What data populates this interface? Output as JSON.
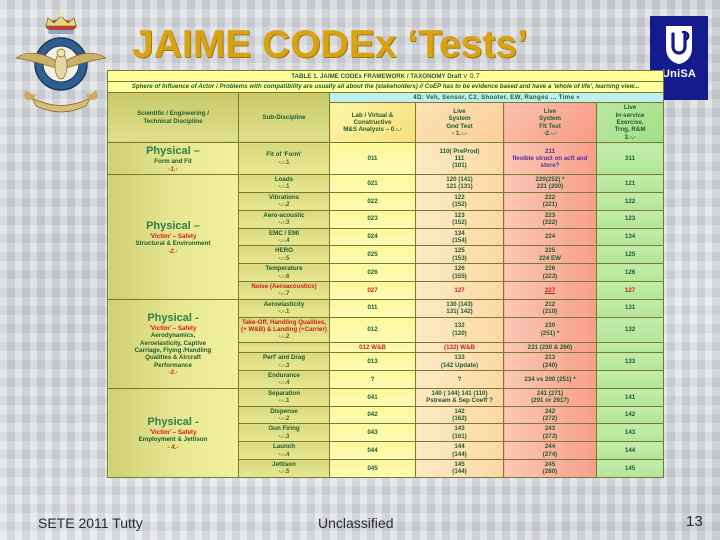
{
  "slide": {
    "title": "JAIME CODEx ‘Tests’",
    "title_color": "#d9a213",
    "background_color": "#c9ccd1"
  },
  "logos": {
    "raaf": "raaf-crest-icon",
    "unisa_label": "UniSA",
    "unisa_color": "#141b8c"
  },
  "table": {
    "title_main": "TABLE 1. JAIME CODEx FRAMEWORK / TAXONOMY Draft",
    "title_version": "v 0.7",
    "subtitle": "Sphere of Influence of Actor / Problems with compatibility are usually all about the (stakeholders) // CoEP has to be evidence based and have a 'whole of life', learning view...",
    "band_4d": "4D: Veh, Sensor, C2, Shooter, EW, Ranges ... Time »",
    "headers": {
      "discipline": "Scientific / Engineering / Technical Discipline",
      "subdiscipline": "Sub-Discipline",
      "col0": "Lab / Virtual & Constructive M&S Analysis – 0.-.-",
      "col1": "Live System Gnd Test - 1.-.-",
      "col2": "Live System Flt Test -2.-.-",
      "col3": "Live In-service Exercise, Trng, R&M 3.-.-"
    },
    "groups": [
      {
        "title": "Physical –",
        "lines": [
          "Form and Fit"
        ],
        "number": "-1.-",
        "victim": false,
        "rows": [
          {
            "sub": "Fit of 'Form'",
            "sub_idx": "-.-.1",
            "sub_red": false,
            "c0": [
              "011"
            ],
            "c1": [
              "110( PreProd)",
              "111",
              "(101)"
            ],
            "c2": [
              "211",
              "flexible struct on acft and store?"
            ],
            "c2_style": "purple",
            "c3": [
              "311"
            ]
          }
        ]
      },
      {
        "title": "Physical –",
        "lines": [
          "'Victim' – Safety",
          "Structural & Environment"
        ],
        "number": "-2.-",
        "victim": true,
        "rows": [
          {
            "sub": "Loads",
            "sub_idx": "-.-.1",
            "c0": [
              "021"
            ],
            "c1": [
              "120 (141)",
              "121 (131)"
            ],
            "c2": [
              "220(252) *",
              "221 (200)"
            ],
            "c3": [
              "121"
            ]
          },
          {
            "sub": "Vibrations",
            "sub_idx": "-.-.2",
            "c0": [
              "022"
            ],
            "c1": [
              "122",
              "(152)"
            ],
            "c2": [
              "222",
              "(221)"
            ],
            "c3": [
              "122"
            ]
          },
          {
            "sub": "Aero-acoustic",
            "sub_idx": "-.-.3",
            "c0": [
              "023"
            ],
            "c1": [
              "123",
              "(152)"
            ],
            "c2": [
              "223",
              "(222)"
            ],
            "c3": [
              "123"
            ]
          },
          {
            "sub": "EMC / EMI",
            "sub_idx": "-.-.4",
            "c0": [
              "024"
            ],
            "c1": [
              "134",
              "(154)"
            ],
            "c2": [
              "224"
            ],
            "c3": [
              "134"
            ]
          },
          {
            "sub": "HERO",
            "sub_idx": "-.-.5",
            "c0": [
              "025"
            ],
            "c1": [
              "125",
              "(153)"
            ],
            "c2": [
              "225",
              "224 EW"
            ],
            "c3": [
              "125"
            ]
          },
          {
            "sub": "Temperature",
            "sub_idx": "-.-.6",
            "c0": [
              "026"
            ],
            "c1": [
              "126",
              "(155)"
            ],
            "c2": [
              "226",
              "(223)"
            ],
            "c3": [
              "126"
            ]
          },
          {
            "sub": "Noise (Aeroacoustics)",
            "sub_idx": "-.-.7",
            "sub_red": true,
            "c0": [
              "027"
            ],
            "c1": [
              "127"
            ],
            "c2": [
              "227"
            ],
            "c3": [
              "127"
            ],
            "row_red": true
          }
        ]
      },
      {
        "title": "Physical -",
        "lines": [
          "'Victim' – Safety",
          "Aerodynamics,",
          "Aeroelasticity, Captive",
          "Carriage, Flying /Handling",
          "Qualities & Aircraft",
          "Performance"
        ],
        "number": "-3.-",
        "victim": true,
        "rows": [
          {
            "sub": "Aeroelasticity",
            "sub_idx": "-.-.1",
            "c0": [
              "011"
            ],
            "c1": [
              "130 (143)",
              "131( 142)"
            ],
            "c2": [
              "212",
              "(210)"
            ],
            "c3": [
              "131"
            ]
          },
          {
            "sub": "Take-Off, Handling Qualities, (+ W&B) & Landing (+Carrier)",
            "sub_idx": "-.-.2",
            "sub_red": true,
            "c0": [
              "012"
            ],
            "c1": [
              "132",
              "(120)"
            ],
            "c2": [
              "230",
              "(251) *"
            ],
            "c3": [
              "132"
            ]
          },
          {
            "sub": "",
            "sub_idx": "",
            "c0": [
              "012 W&B"
            ],
            "c0_red": true,
            "c1": [
              "(132) W&B"
            ],
            "c1_red": true,
            "c2": [
              "231 (230 & 260)"
            ],
            "c3": [
              ""
            ]
          },
          {
            "sub": "Perf' and Drag",
            "sub_idx": "-.-.3",
            "c0": [
              "013"
            ],
            "c1": [
              "133",
              "(142 Update)"
            ],
            "c2": [
              "213",
              "(240)"
            ],
            "c3": [
              "133"
            ]
          },
          {
            "sub": "Endurance",
            "sub_idx": "-.-.4",
            "c0": [
              "?"
            ],
            "c1": [
              "?"
            ],
            "c2": [
              "234 vs 200 (251) *"
            ],
            "c3": [
              ""
            ]
          }
        ]
      },
      {
        "title": "Physical -",
        "lines": [
          "'Victim' – Safety",
          "Employment & Jettison"
        ],
        "number": "- 4.-",
        "victim": true,
        "rows": [
          {
            "sub": "Separation",
            "sub_idx": "-.-.1",
            "c0": [
              "041"
            ],
            "c1": [
              "140 ( 144) 141 (110)",
              "Pstream & Sep Coeff ?"
            ],
            "c2": [
              "241 (271)",
              "(291 or 2917)"
            ],
            "c3": [
              "141"
            ]
          },
          {
            "sub": "Dispense",
            "sub_idx": "-.-.2",
            "c0": [
              "042"
            ],
            "c1": [
              "142",
              "(162)"
            ],
            "c2": [
              "242",
              "(272)"
            ],
            "c3": [
              "142"
            ]
          },
          {
            "sub": "Gun Firing",
            "sub_idx": "-.-.3",
            "c0": [
              "043"
            ],
            "c1": [
              "143",
              "(161)"
            ],
            "c2": [
              "243",
              "(273)"
            ],
            "c3": [
              "143"
            ]
          },
          {
            "sub": "Launch",
            "sub_idx": "-.-.4",
            "c0": [
              "044"
            ],
            "c1": [
              "144",
              "(144)"
            ],
            "c2": [
              "244",
              "(274)"
            ],
            "c3": [
              "144"
            ]
          },
          {
            "sub": "Jettison",
            "sub_idx": "-.-.5",
            "c0": [
              "045"
            ],
            "c1": [
              "145",
              "(144)"
            ],
            "c2": [
              "245",
              "(280)"
            ],
            "c3": [
              "145"
            ]
          }
        ]
      }
    ]
  },
  "footer": {
    "left": "SETE 2011 Tutty",
    "center": "Unclassified",
    "right": "13"
  }
}
